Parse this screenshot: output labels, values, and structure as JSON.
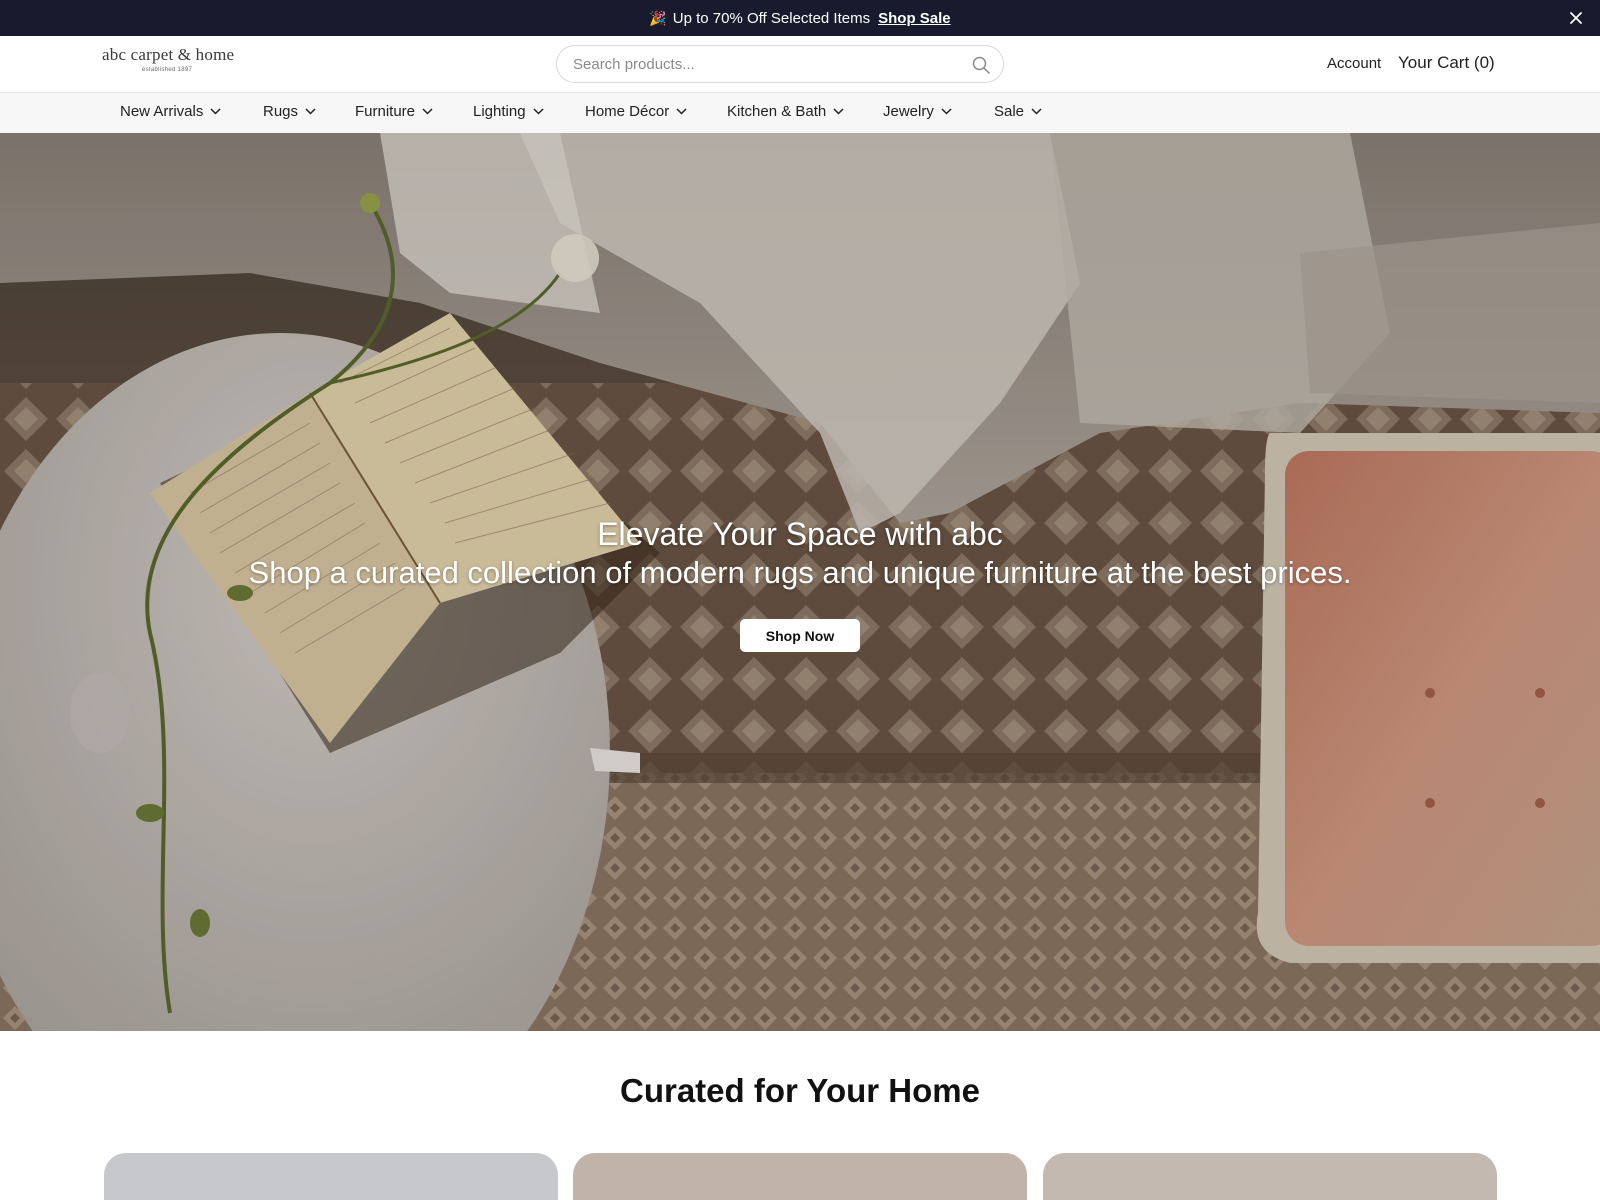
{
  "announcement": {
    "text": "Up to 70% Off Selected Items",
    "link_label": "Shop Sale",
    "icons": [
      "party-popper-icon",
      "close-icon"
    ]
  },
  "header": {
    "logo_line1": "abc carpet & home",
    "logo_line2": "established 1897",
    "search_placeholder": "Search products...",
    "account_label": "Account",
    "cart_label": "Your Cart (0)"
  },
  "nav": {
    "items": [
      {
        "label": "New Arrivals"
      },
      {
        "label": "Rugs"
      },
      {
        "label": "Furniture"
      },
      {
        "label": "Lighting"
      },
      {
        "label": "Home Décor"
      },
      {
        "label": "Kitchen & Bath"
      },
      {
        "label": "Jewelry"
      },
      {
        "label": "Sale"
      }
    ]
  },
  "hero": {
    "title": "Elevate Your Space with abc",
    "subtitle": "Shop a curated collection of modern rugs and unique furniture at the best prices.",
    "button_label": "Shop Now"
  },
  "curated": {
    "title": "Curated for Your Home",
    "card_colors": [
      "#c7c8cc",
      "#c0b4aa",
      "#c4b9b0"
    ]
  },
  "colors": {
    "announce_bg": "#181a2e",
    "nav_bg": "#f7f7f8",
    "rug_tone": "#7b6654",
    "cushion": "#c8836a"
  }
}
